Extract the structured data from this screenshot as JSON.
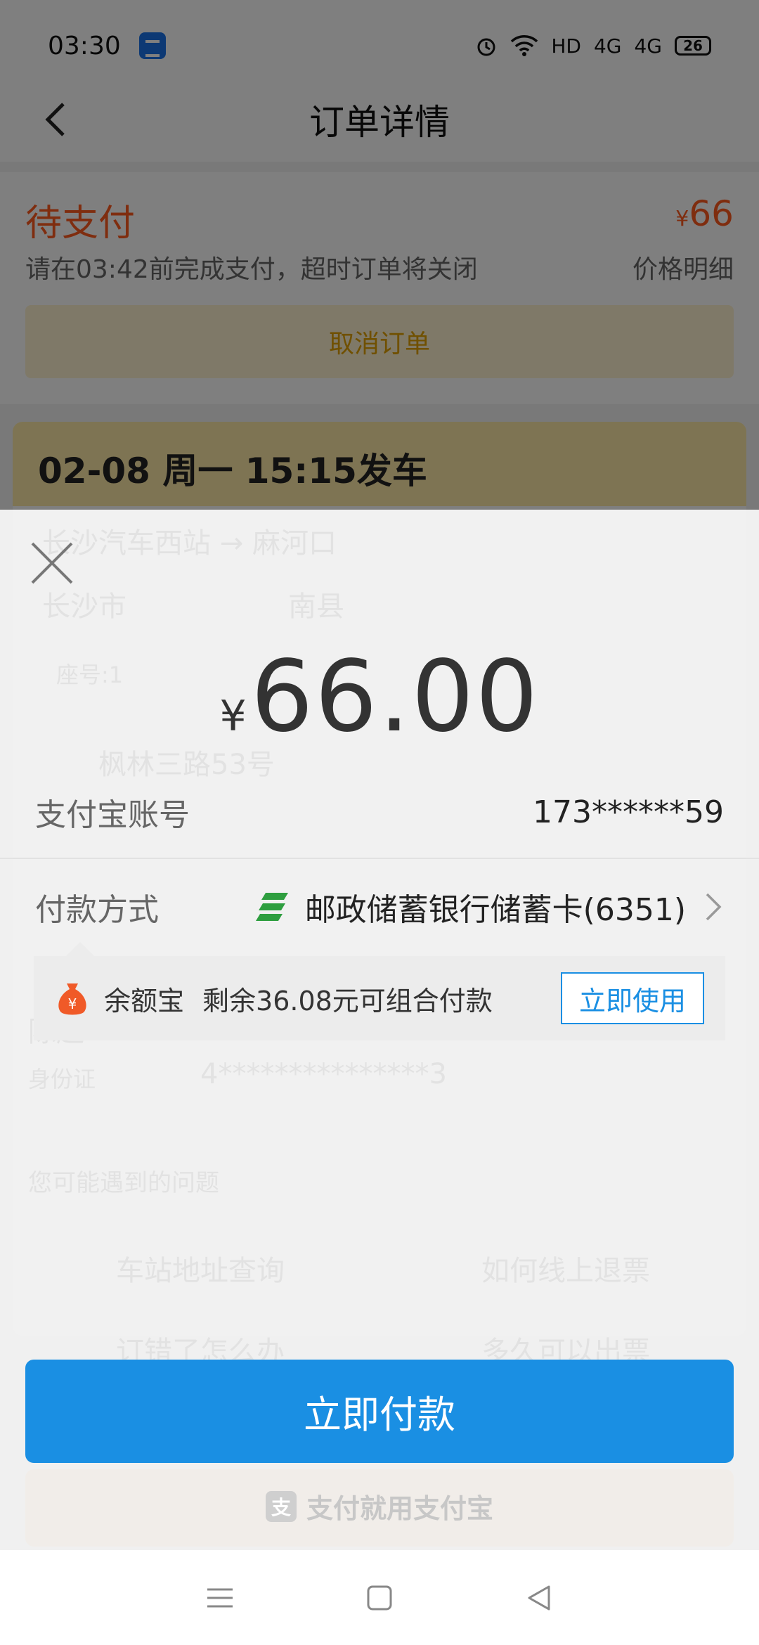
{
  "status_bar": {
    "time": "03:30",
    "network": "HD",
    "signal1": "4G",
    "signal2": "4G",
    "battery": "26"
  },
  "nav": {
    "title": "订单详情"
  },
  "order_status": {
    "state": "待支付",
    "currency_symbol": "¥",
    "amount": "66",
    "deadline_text": "请在03:42前完成支付，超时订单将关闭",
    "price_detail_label": "价格明细",
    "cancel_label": "取消订单"
  },
  "trip": {
    "departure_label": "02-08 周一 15:15发车",
    "route": "长沙汽车西站 → 麻河口",
    "origin_city": "长沙市",
    "destination_city": "南县",
    "seat_info": "座号:1",
    "address": "枫林三路53号",
    "passenger_name": "陈超",
    "id_label": "身份证",
    "id_number": "4***************3",
    "help_title": "您可能遇到的问题",
    "help_items": [
      "车站地址查询",
      "如何线上退票",
      "订错了怎么办",
      "多久可以出票"
    ]
  },
  "payment_sheet": {
    "currency_symbol": "¥",
    "amount": "66.00",
    "account_label": "支付宝账号",
    "account_value": "173******59",
    "method_label": "付款方式",
    "method_value": "邮政储蓄银行储蓄卡(6351)",
    "yuebao_name": "余额宝",
    "yuebao_desc": "剩余36.08元可组合付款",
    "yuebao_action": "立即使用",
    "pay_button": "立即付款",
    "brand_text": "支付就用支付宝"
  },
  "colors": {
    "accent_blue": "#1a8fe3",
    "pending_orange": "#ff5a1f",
    "bank_green": "#2e9e3f"
  }
}
